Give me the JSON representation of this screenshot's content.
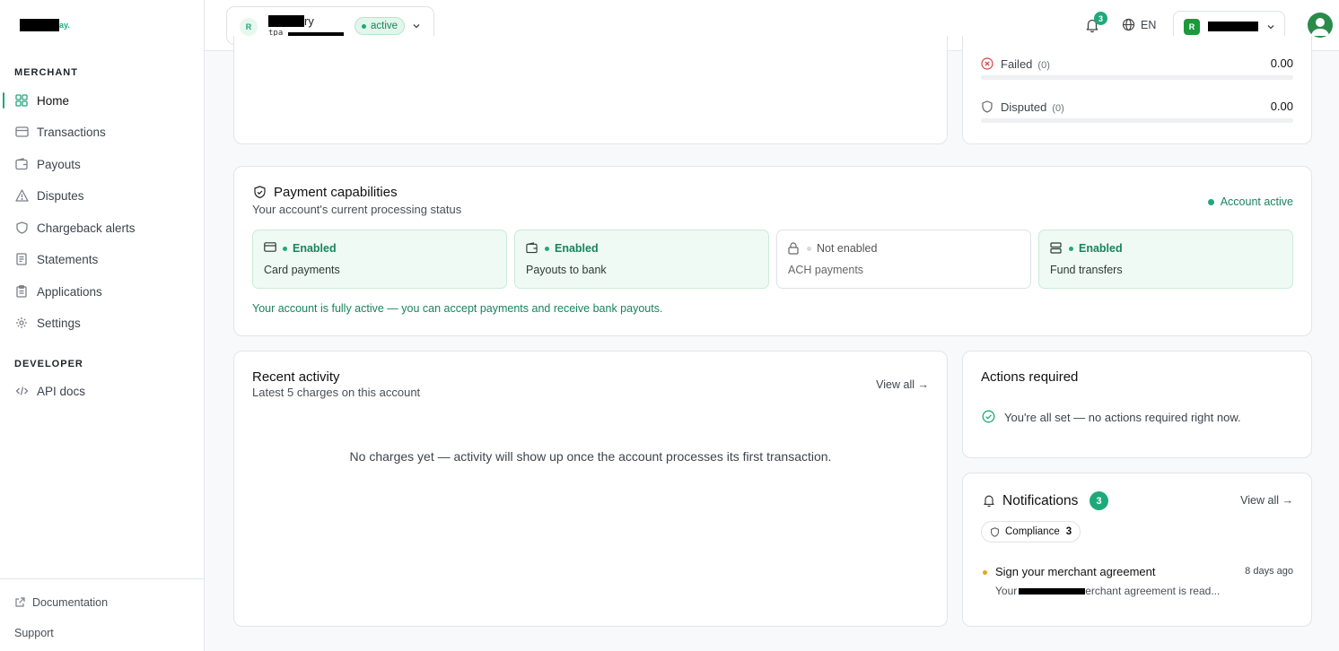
{
  "brand": {
    "logo_suffix": "ay."
  },
  "sidebar": {
    "merchant_label": "MERCHANT",
    "items": [
      {
        "label": "Home",
        "icon": "grid-icon"
      },
      {
        "label": "Transactions",
        "icon": "card-icon"
      },
      {
        "label": "Payouts",
        "icon": "wallet-icon"
      },
      {
        "label": "Disputes",
        "icon": "warning-icon"
      },
      {
        "label": "Chargeback alerts",
        "icon": "shield-icon"
      },
      {
        "label": "Statements",
        "icon": "document-icon"
      },
      {
        "label": "Applications",
        "icon": "clipboard-icon"
      },
      {
        "label": "Settings",
        "icon": "gear-icon"
      }
    ],
    "developer_label": "DEVELOPER",
    "dev_items": [
      {
        "label": "API docs",
        "icon": "code-icon"
      }
    ],
    "footer": {
      "documentation": "Documentation",
      "support": "Support"
    }
  },
  "topbar": {
    "account": {
      "avatar": "R",
      "name_suffix": "ry",
      "id_prefix": "tpa_",
      "status": "active"
    },
    "notification_count": "3",
    "language": "EN",
    "user": {
      "avatar": "R"
    }
  },
  "balances": {
    "failed": {
      "label": "Failed",
      "count": "(0)",
      "value": "0.00"
    },
    "disputed": {
      "label": "Disputed",
      "count": "(0)",
      "value": "0.00"
    }
  },
  "capabilities": {
    "title": "Payment capabilities",
    "subtitle": "Your account's current processing status",
    "status": "Account active",
    "items": [
      {
        "state": "Enabled",
        "label": "Card payments"
      },
      {
        "state": "Enabled",
        "label": "Payouts to bank"
      },
      {
        "state": "Not enabled",
        "label": "ACH payments"
      },
      {
        "state": "Enabled",
        "label": "Fund transfers"
      }
    ],
    "message": "Your account is fully active — you can accept payments and receive bank payouts."
  },
  "recent_activity": {
    "title": "Recent activity",
    "subtitle": "Latest 5 charges on this account",
    "view_all": "View all →",
    "empty": "No charges yet — activity will show up once the account processes its first transaction."
  },
  "actions": {
    "title": "Actions required",
    "message": "You're all set — no actions required right now."
  },
  "notifications": {
    "title": "Notifications",
    "count": "3",
    "view_all": "View all →",
    "filter": {
      "label": "Compliance",
      "count": "3"
    },
    "items": [
      {
        "title": "Sign your merchant agreement",
        "time": "8 days ago",
        "desc_prefix": "Your ",
        "desc_suffix": "erchant agreement is read..."
      }
    ]
  }
}
